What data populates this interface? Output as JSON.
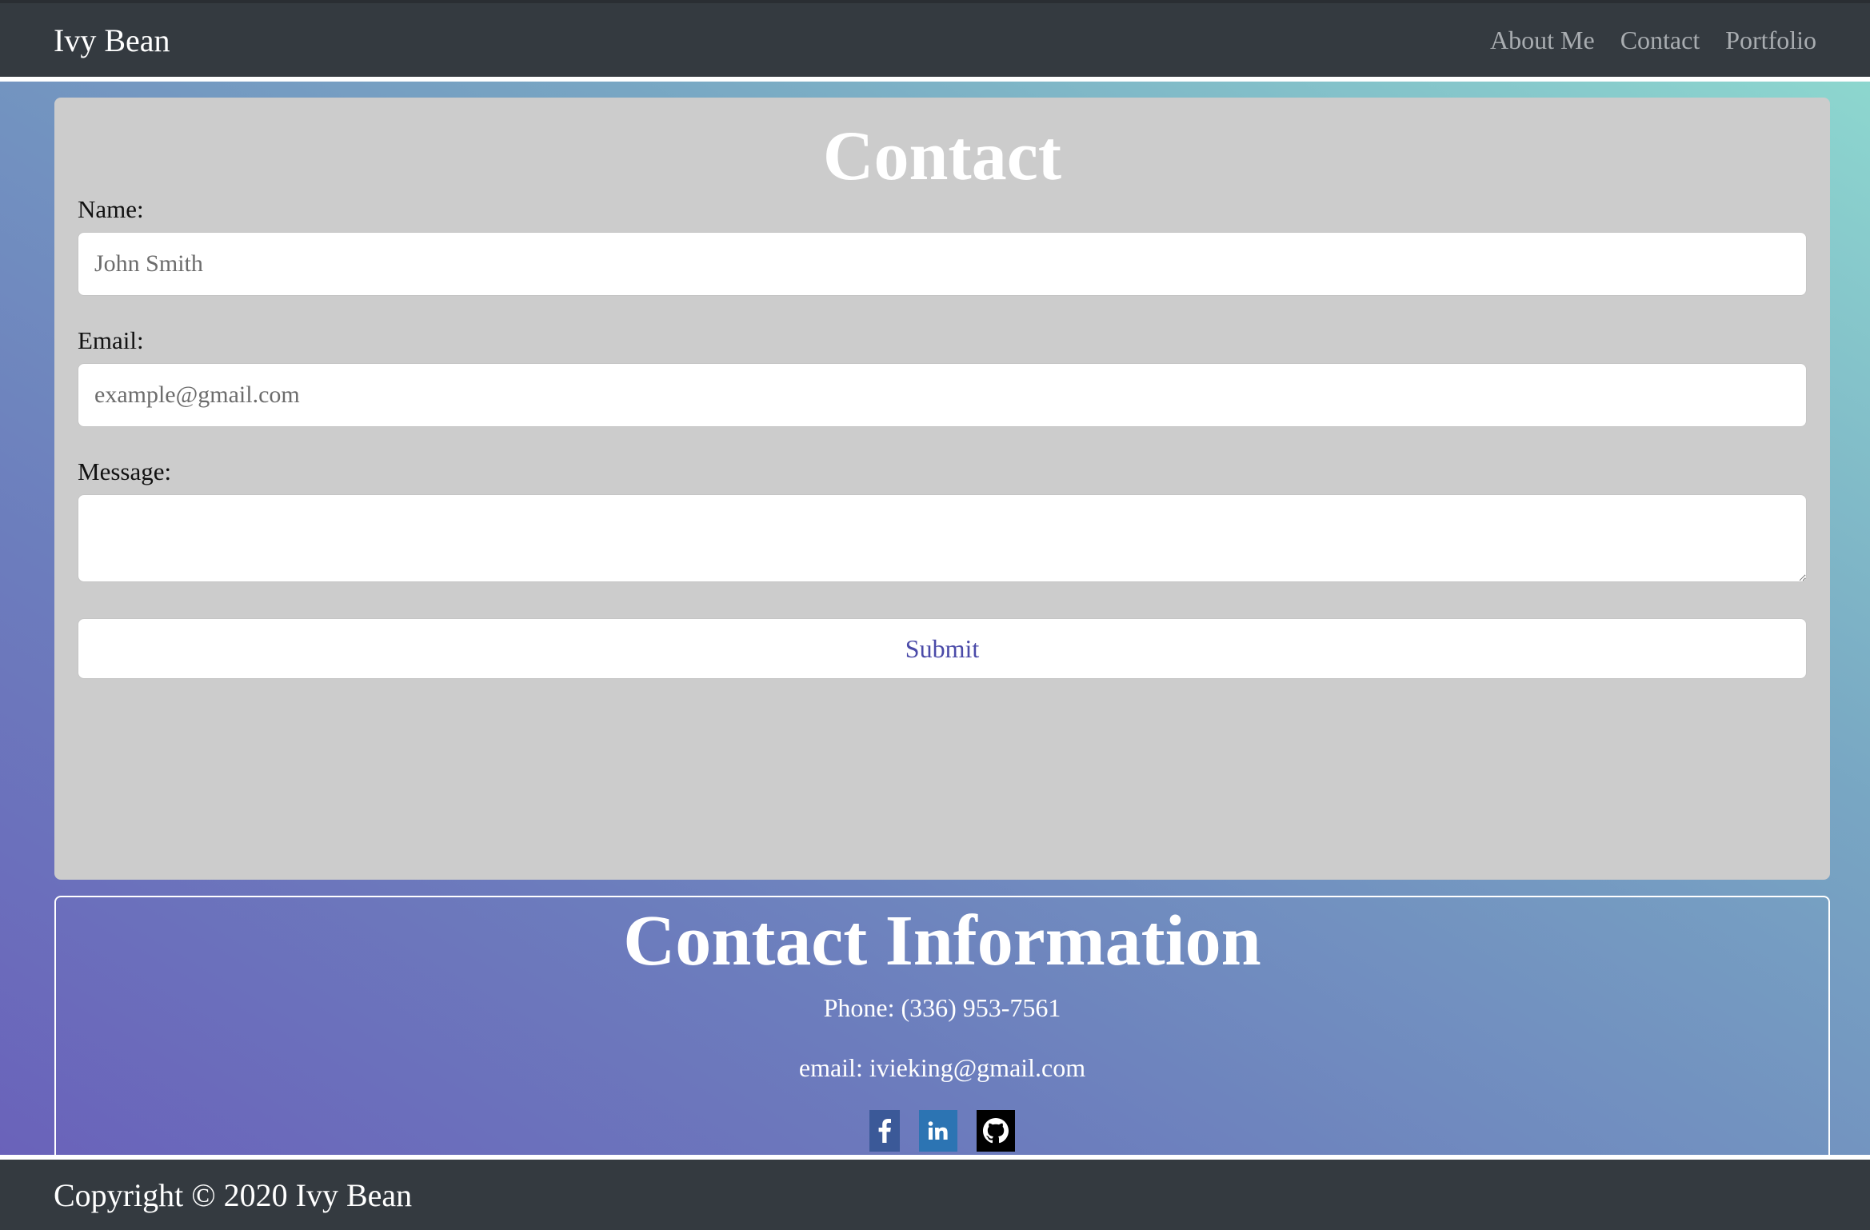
{
  "header": {
    "brand": "Ivy Bean",
    "nav": [
      "About Me",
      "Contact",
      "Portfolio"
    ]
  },
  "contact_form": {
    "title": "Contact",
    "name_label": "Name:",
    "name_placeholder": "John Smith",
    "email_label": "Email:",
    "email_placeholder": "example@gmail.com",
    "message_label": "Message:",
    "message_value": "",
    "submit_label": "Submit"
  },
  "contact_info": {
    "title": "Contact Information",
    "phone": "Phone: (336) 953-7561",
    "email": "email: ivieking@gmail.com",
    "social_icons": [
      "facebook-icon",
      "linkedin-icon",
      "github-icon"
    ]
  },
  "footer": {
    "copyright": "Copyright © 2020 Ivy Bean"
  },
  "colors": {
    "navbar": "#343a40",
    "card": "#cccccc",
    "submit_text": "#4a4aa8",
    "facebook": "#3b5998",
    "linkedin": "#2c74b3",
    "github": "#000000"
  }
}
